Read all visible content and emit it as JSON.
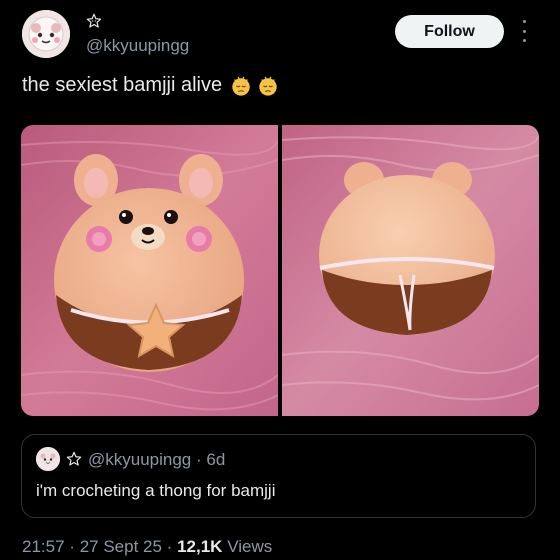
{
  "author": {
    "handle": "@kkyuupingg",
    "badge_icon": "star-outline-icon"
  },
  "header": {
    "follow_label": "Follow",
    "more_icon": "vertical-dots-icon"
  },
  "tweet": {
    "text": "the sexiest bamjji alive",
    "emoji": [
      "sad-face-emoji",
      "sad-face-emoji"
    ]
  },
  "quote": {
    "handle": "@kkyuupingg",
    "separator": "·",
    "age": "6d",
    "text": "i'm crocheting a thong for bamjji"
  },
  "meta": {
    "time": "21:57",
    "sep1": "·",
    "date": "27 Sept 25",
    "sep2": "·",
    "views_count": "12,1K",
    "views_label": "Views"
  },
  "colors": {
    "background": "#000000",
    "text": "#e7e9ea",
    "muted": "#8b98a5",
    "follow_bg": "#eff3f4"
  }
}
